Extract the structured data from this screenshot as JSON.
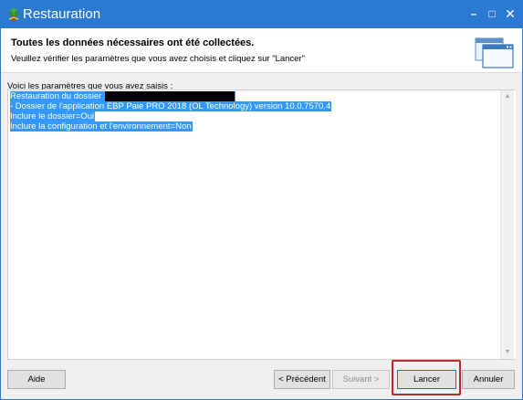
{
  "window": {
    "title": "Restauration",
    "minimize_glyph": "–",
    "maximize_glyph": "□",
    "close_glyph": "✕",
    "accent_color": "#2b79d0"
  },
  "header": {
    "title": "Toutes les données nécessaires ont été collectées.",
    "subtitle": "Veuillez vérifier les paramètres que vous avez choisis et cliquez sur \"Lancer\"",
    "icon": "window-dialog-icon"
  },
  "summary": {
    "intro": "Voici les paramètres que vous avez saisis :",
    "lines": [
      "Restauration du dossier",
      "- Dossier de l'application EBP Paie PRO 2018 (OL Technology) version 10.0.7570.4",
      "Inclure le dossier=Oui",
      "Inclure la configuration et l'environnement=Non"
    ],
    "selection_color": "#3399ff"
  },
  "scrollbar": {
    "up_glyph": "▲",
    "down_glyph": "▼"
  },
  "buttons": {
    "help": "Aide",
    "previous": "< Précédent",
    "next": "Suivant >",
    "launch": "Lancer",
    "cancel": "Annuler"
  },
  "annotation": {
    "highlight_color": "#c0272d",
    "highlighted": "Lancer"
  }
}
